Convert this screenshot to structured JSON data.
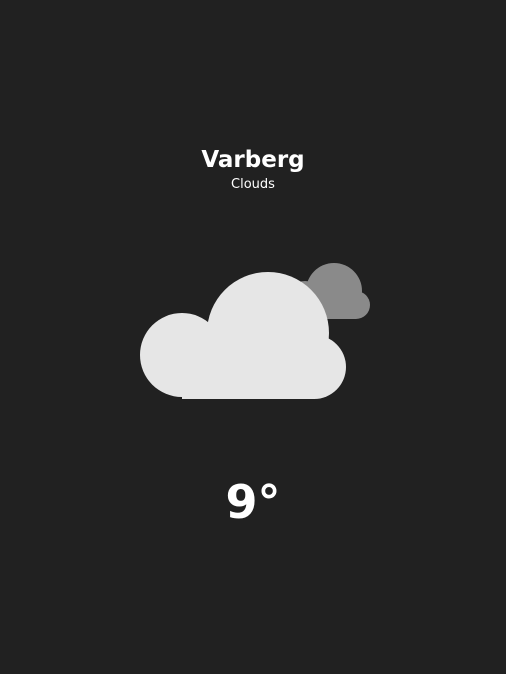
{
  "weather": {
    "city": "Varberg",
    "condition": "Clouds",
    "temperature": "9°",
    "icon": "clouds-icon"
  },
  "colors": {
    "background": "#212121",
    "text": "#ffffff",
    "cloud_front": "#e6e6e6",
    "cloud_back": "#8a8a8a"
  }
}
